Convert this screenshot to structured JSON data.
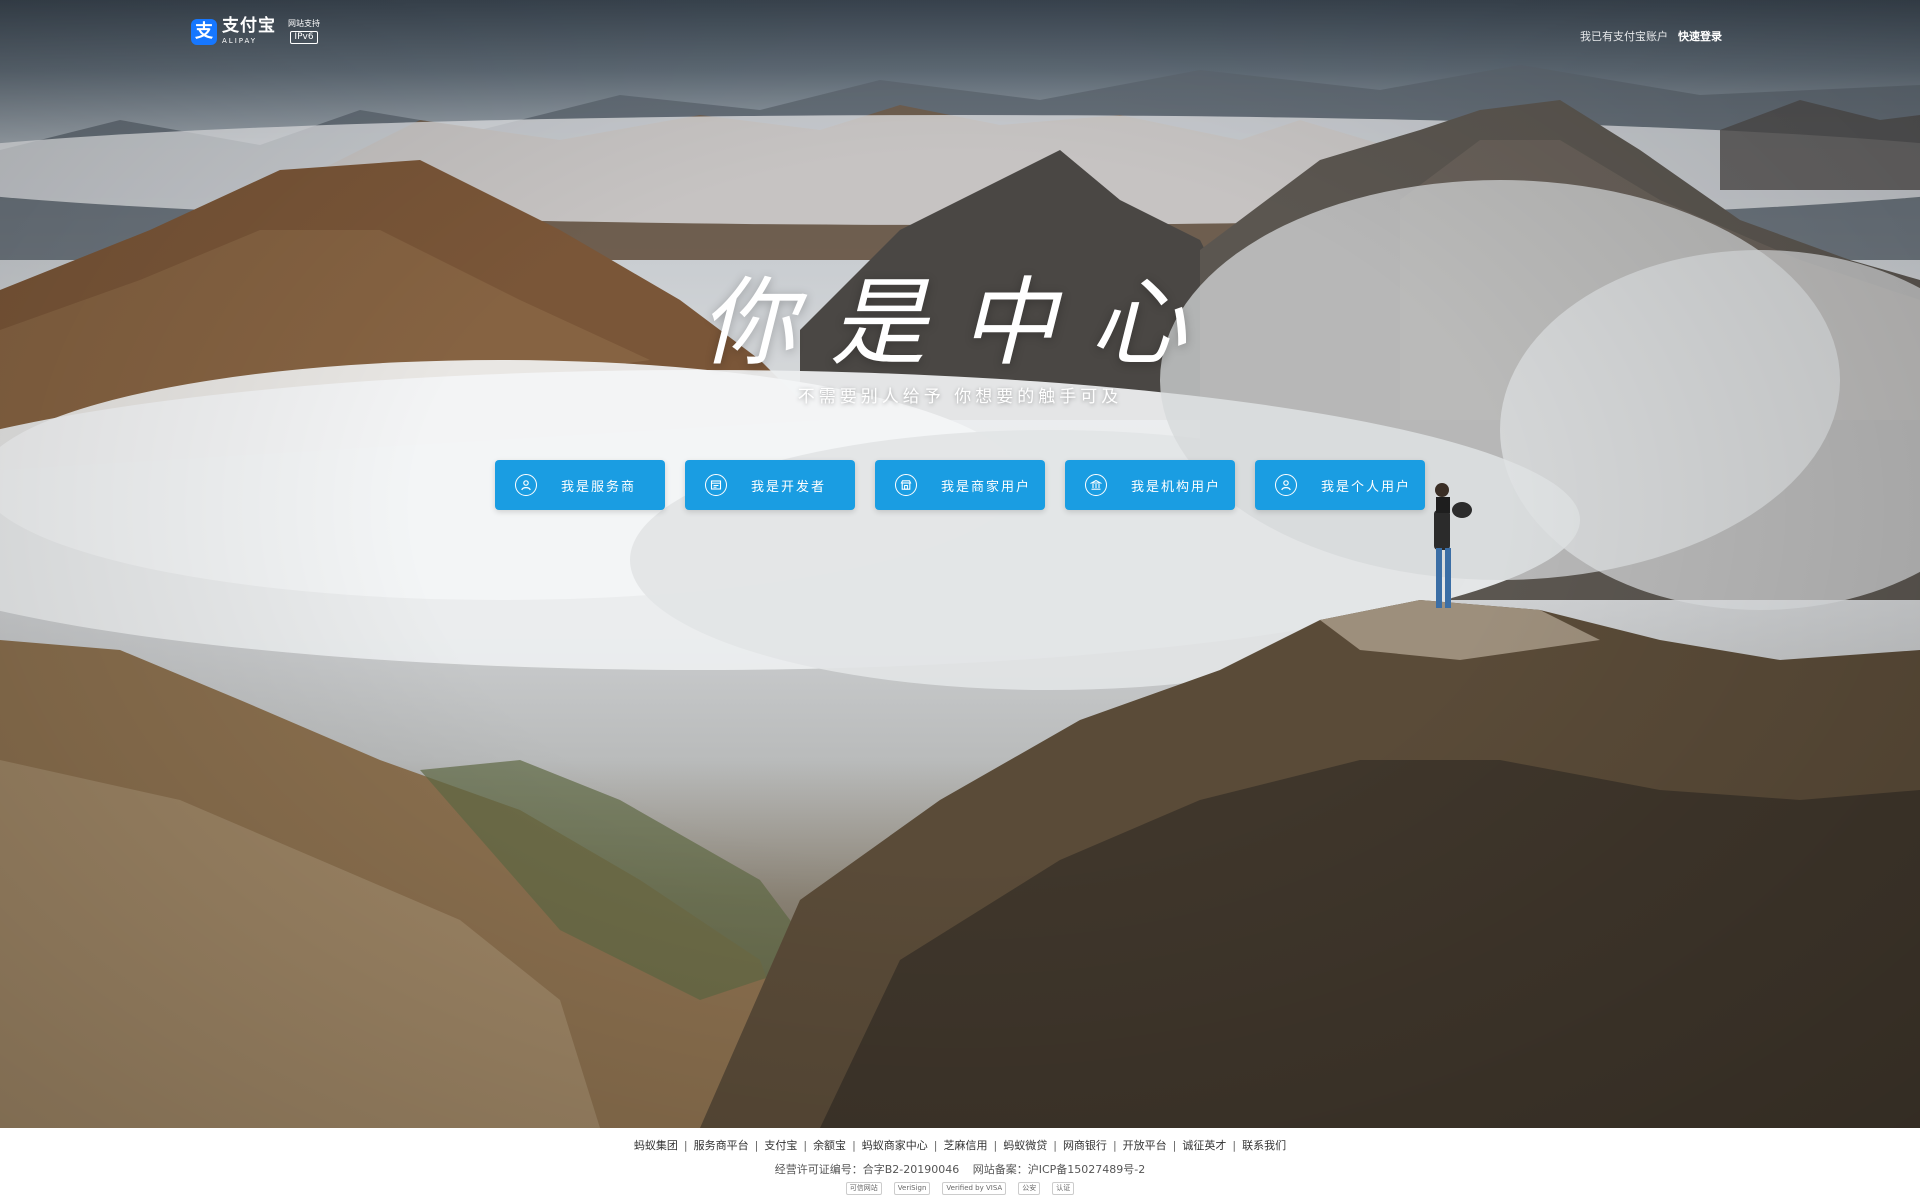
{
  "header": {
    "logo_cn": "支付宝",
    "logo_en": "ALIPAY",
    "logo_icon": "支",
    "ipv6_label": "网站支持",
    "ipv6_badge": "IPv6",
    "has_account_text": "我已有支付宝账户",
    "quick_login": "快速登录"
  },
  "hero": {
    "slogan": "你是中心",
    "subtitle": "不需要别人给予  你想要的触手可及"
  },
  "roles": [
    {
      "label": "我是服务商",
      "icon": "user-circle-icon"
    },
    {
      "label": "我是开发者",
      "icon": "developer-window-icon"
    },
    {
      "label": "我是商家用户",
      "icon": "shop-icon"
    },
    {
      "label": "我是机构用户",
      "icon": "institution-icon"
    },
    {
      "label": "我是个人用户",
      "icon": "person-icon"
    }
  ],
  "footer": {
    "links": [
      "蚂蚁集团",
      "服务商平台",
      "支付宝",
      "余额宝",
      "蚂蚁商家中心",
      "芝麻信用",
      "蚂蚁微贷",
      "网商银行",
      "开放平台",
      "诚征英才",
      "联系我们"
    ],
    "license": "经营许可证编号：合字B2-20190046",
    "icp": "网站备案：沪ICP备15027489号-2",
    "badges": [
      "可信网站",
      "VeriSign",
      "Verified by VISA",
      "公安",
      "认证"
    ]
  },
  "colors": {
    "button_blue": "#1a9de2",
    "brand_blue": "#1677ff"
  }
}
